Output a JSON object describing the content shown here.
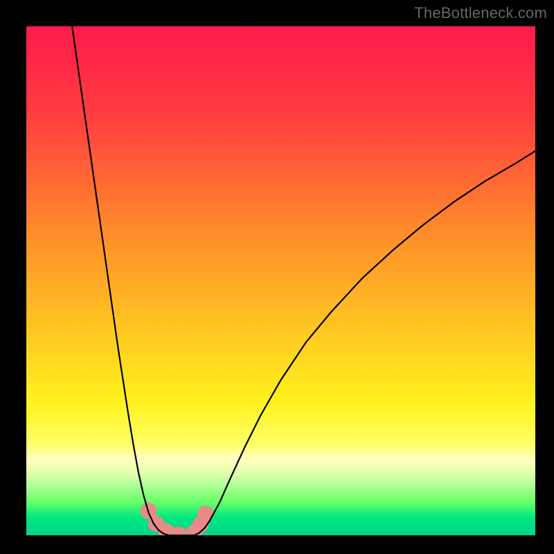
{
  "watermark": "TheBottleneck.com",
  "chart_data": {
    "type": "line",
    "title": "",
    "xlabel": "",
    "ylabel": "",
    "xlim": [
      0,
      100
    ],
    "ylim": [
      0,
      100
    ],
    "gradient_stops": [
      {
        "offset": 0.0,
        "color": "#ff1a4b"
      },
      {
        "offset": 0.18,
        "color": "#ff3f3f"
      },
      {
        "offset": 0.4,
        "color": "#ff8a2a"
      },
      {
        "offset": 0.58,
        "color": "#ffc222"
      },
      {
        "offset": 0.74,
        "color": "#fff21e"
      },
      {
        "offset": 0.82,
        "color": "#ffff66"
      },
      {
        "offset": 0.85,
        "color": "#ffffc0"
      },
      {
        "offset": 0.875,
        "color": "#e7ffb0"
      },
      {
        "offset": 0.9,
        "color": "#b3ff99"
      },
      {
        "offset": 0.935,
        "color": "#66ff66"
      },
      {
        "offset": 0.965,
        "color": "#00e880"
      },
      {
        "offset": 1.0,
        "color": "#00d48a"
      }
    ],
    "series": [
      {
        "name": "left-curve",
        "stroke": "#000000",
        "x": [
          9,
          10,
          11,
          12,
          13,
          14,
          15,
          16,
          17,
          18,
          19,
          20,
          21,
          22,
          23,
          24,
          25,
          26,
          27,
          28
        ],
        "values": [
          100,
          93,
          86,
          79,
          72,
          65,
          58,
          51,
          44,
          37,
          30.5,
          24,
          18,
          12.5,
          8,
          4.5,
          2.3,
          1.0,
          0.3,
          0.0
        ]
      },
      {
        "name": "right-curve",
        "stroke": "#000000",
        "x": [
          33,
          34,
          35,
          36,
          38,
          40,
          43,
          46,
          50,
          55,
          60,
          66,
          72,
          78,
          84,
          90,
          96,
          100
        ],
        "values": [
          0.0,
          0.5,
          1.4,
          2.8,
          6.5,
          11.0,
          17.5,
          23.5,
          30.5,
          38.0,
          44.0,
          50.5,
          56.0,
          61.0,
          65.5,
          69.5,
          73.0,
          75.5
        ]
      },
      {
        "name": "bottom-connector",
        "stroke": "#000000",
        "x": [
          28,
          29,
          30,
          31,
          32,
          33
        ],
        "values": [
          0.0,
          0.0,
          0.0,
          0.0,
          0.0,
          0.0
        ]
      }
    ],
    "markers": {
      "name": "highlight-blobs",
      "fill": "#e88a8a",
      "points": [
        {
          "x": 24.0,
          "y": 4.8
        },
        {
          "x": 25.5,
          "y": 2.3
        },
        {
          "x": 27.5,
          "y": 0.8
        },
        {
          "x": 30.0,
          "y": 0.1
        },
        {
          "x": 33.0,
          "y": 0.6
        },
        {
          "x": 34.2,
          "y": 2.1
        },
        {
          "x": 35.2,
          "y": 4.2
        }
      ],
      "radius_data_units": 1.6
    }
  }
}
